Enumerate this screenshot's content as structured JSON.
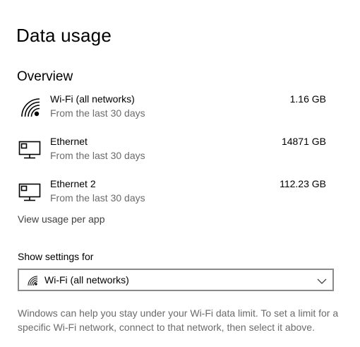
{
  "page": {
    "title": "Data usage"
  },
  "overview": {
    "title": "Overview",
    "items": [
      {
        "name": "Wi-Fi (all networks)",
        "subtitle": "From the last 30 days",
        "amount": "1.16 GB",
        "icon": "wifi-icon"
      },
      {
        "name": "Ethernet",
        "subtitle": "From the last 30 days",
        "amount": "14871 GB",
        "icon": "ethernet-icon"
      },
      {
        "name": "Ethernet 2",
        "subtitle": "From the last 30 days",
        "amount": "112.23 GB",
        "icon": "ethernet-icon"
      }
    ],
    "link_label": "View usage per app"
  },
  "settings": {
    "label": "Show settings for",
    "selected": "Wi-Fi (all networks)",
    "selected_icon": "wifi-icon",
    "help_text": "Windows can help you stay under your Wi-Fi data limit. To set a limit for a specific Wi-Fi network, connect to that network, then select it above."
  }
}
